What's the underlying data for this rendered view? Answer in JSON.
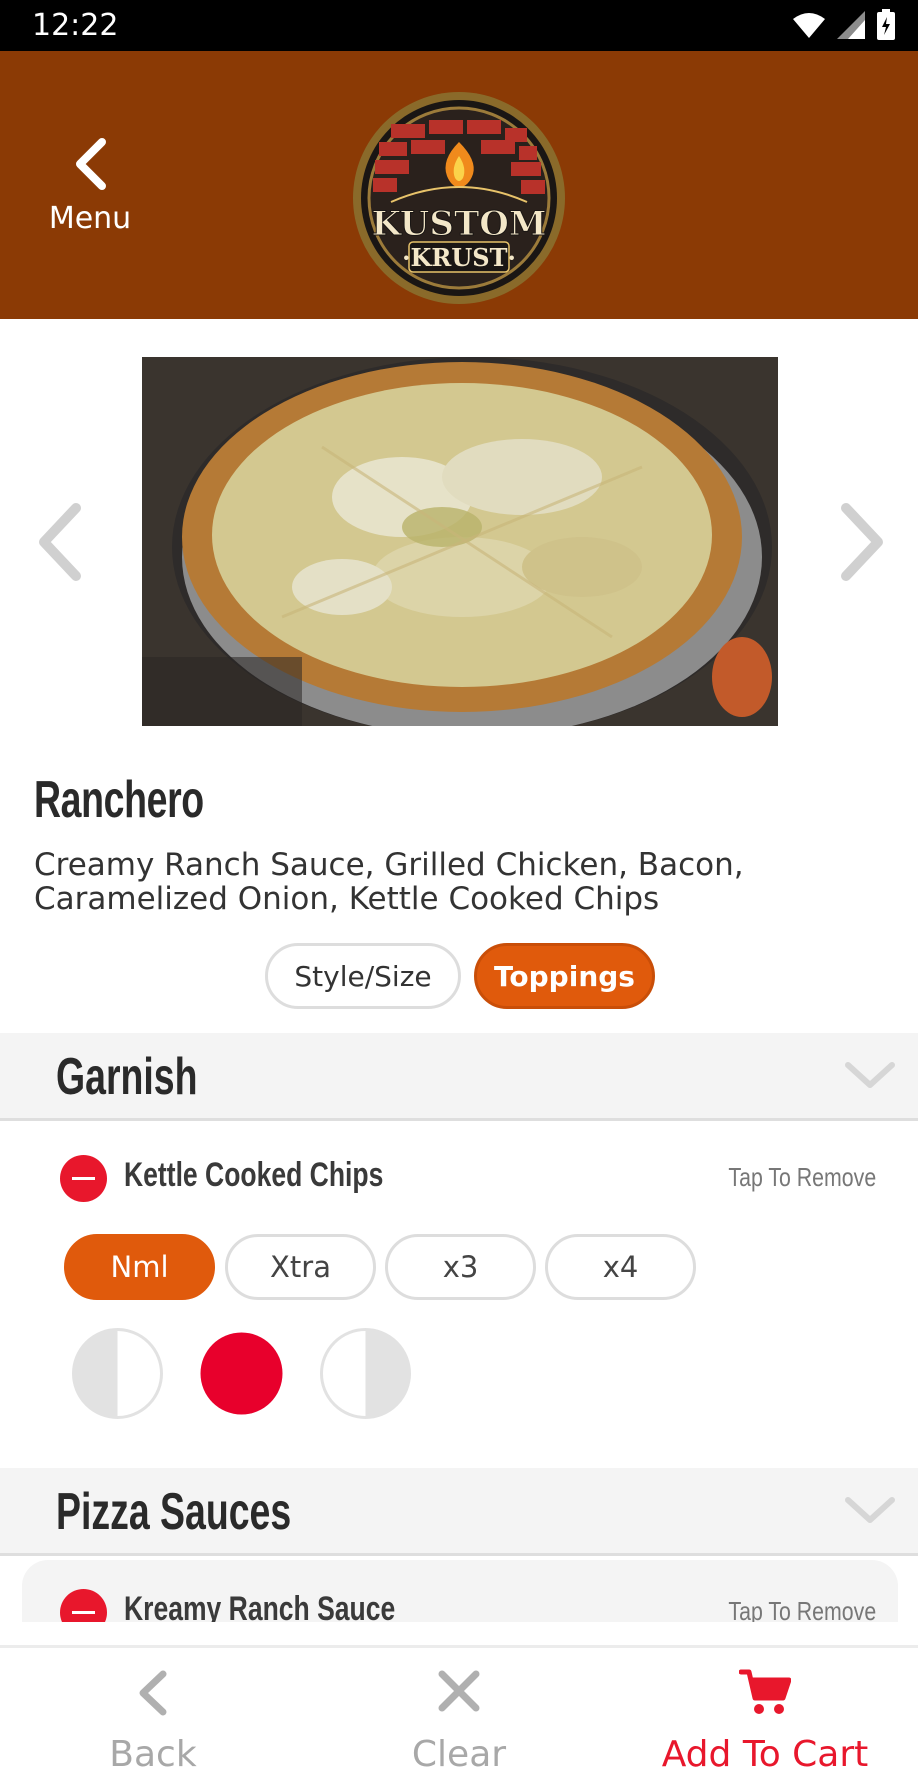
{
  "status_bar": {
    "time": "12:22"
  },
  "header": {
    "back_label": "Menu",
    "logo_icon": "kustom-krust-logo"
  },
  "carousel": {
    "image_icon": "pizza-photo"
  },
  "item": {
    "title": "Ranchero",
    "description": "Creamy Ranch Sauce, Grilled Chicken, Bacon, Caramelized Onion, Kettle Cooked Chips"
  },
  "tabs": [
    {
      "label": "Style/Size",
      "selected": false
    },
    {
      "label": "Toppings",
      "selected": true
    }
  ],
  "sections": [
    {
      "title": "Garnish",
      "toppings": [
        {
          "name": "Kettle Cooked Chips",
          "action": "Tap To Remove",
          "amounts": [
            "Nml",
            "Xtra",
            "x3",
            "x4"
          ],
          "selected_amount": "Nml",
          "portions": [
            "left-half",
            "whole",
            "right-half"
          ],
          "selected_portion": "whole"
        }
      ]
    },
    {
      "title": "Pizza Sauces",
      "toppings": [
        {
          "name": "Kreamy Ranch Sauce",
          "action": "Tap To Remove"
        }
      ]
    }
  ],
  "bottom_bar": {
    "back_label": "Back",
    "clear_label": "Clear",
    "cart_label": "Add To Cart"
  },
  "colors": {
    "header_bg": "#8b3a05",
    "accent_orange": "#e05a0c",
    "accent_red": "#e8172c",
    "muted_gray": "#a8a8a8"
  }
}
